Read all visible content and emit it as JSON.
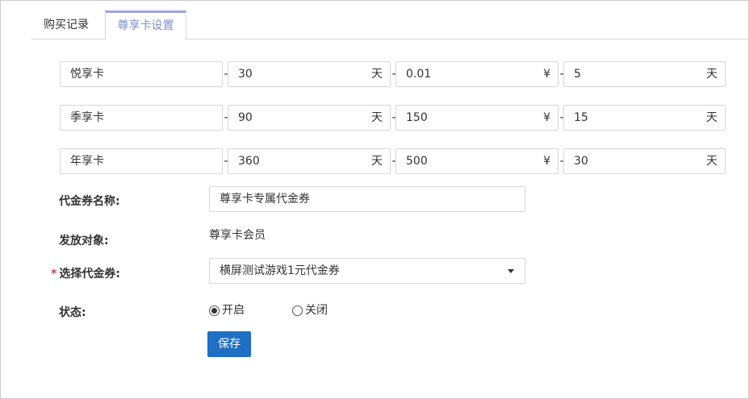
{
  "tabs": [
    {
      "label": "购买记录"
    },
    {
      "label": "尊享卡设置",
      "active": true
    }
  ],
  "cards": [
    {
      "name": "悦享卡",
      "days": "30",
      "days_unit": "天",
      "price": "0.01",
      "price_unit": "¥",
      "bonus": "5",
      "bonus_unit": "天"
    },
    {
      "name": "季享卡",
      "days": "90",
      "days_unit": "天",
      "price": "150",
      "price_unit": "¥",
      "bonus": "15",
      "bonus_unit": "天"
    },
    {
      "name": "年享卡",
      "days": "360",
      "days_unit": "天",
      "price": "500",
      "price_unit": "¥",
      "bonus": "30",
      "bonus_unit": "天"
    }
  ],
  "separator": "-",
  "form": {
    "voucher_name_label": "代金券名称:",
    "voucher_name_value": "尊享卡专属代金券",
    "target_label": "发放对象:",
    "target_value": "尊享卡会员",
    "required_mark": "*",
    "select_voucher_label": "选择代金券:",
    "select_voucher_value": "横屏测试游戏1元代金券",
    "status_label": "状态:",
    "status_on": "开启",
    "status_off": "关闭",
    "status_selected": "开启",
    "save_label": "保存"
  },
  "colors": {
    "active_tab": "#7e8fcf",
    "primary_button": "#1f6fc4",
    "required": "#e23c3c"
  }
}
